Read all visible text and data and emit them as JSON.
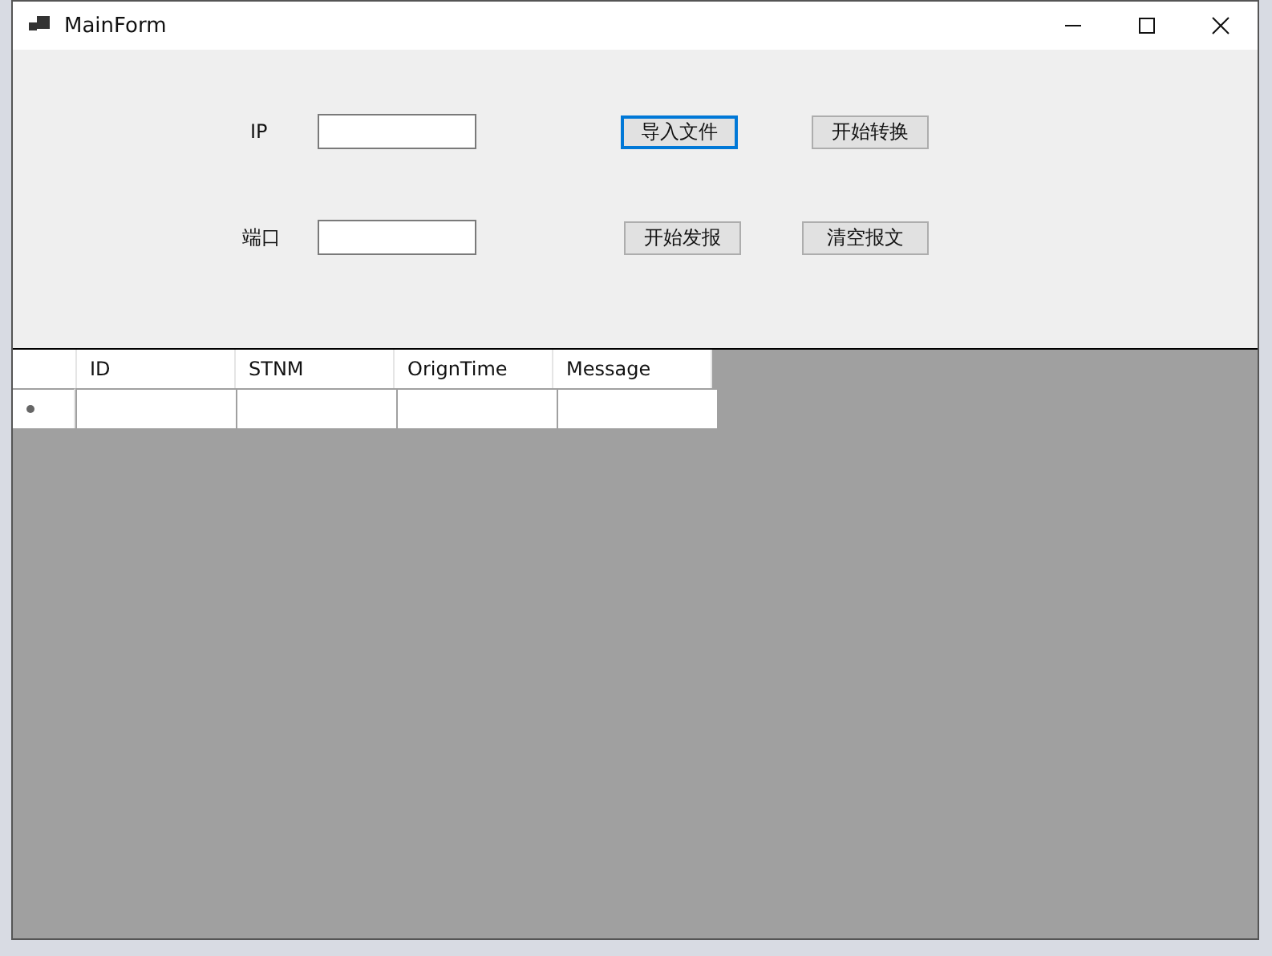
{
  "window": {
    "title": "MainForm"
  },
  "form_rows": [
    {
      "label": "IP",
      "buttons": [
        {
          "label": "导入文件",
          "focused": true
        },
        {
          "label": "开始转换",
          "focused": false
        }
      ]
    },
    {
      "label": "端口",
      "buttons": [
        {
          "label": "开始发报",
          "focused": false
        },
        {
          "label": "清空报文",
          "focused": false
        }
      ]
    }
  ],
  "grid": {
    "columns": [
      "ID",
      "STNM",
      "OrignTime",
      "Message"
    ]
  }
}
